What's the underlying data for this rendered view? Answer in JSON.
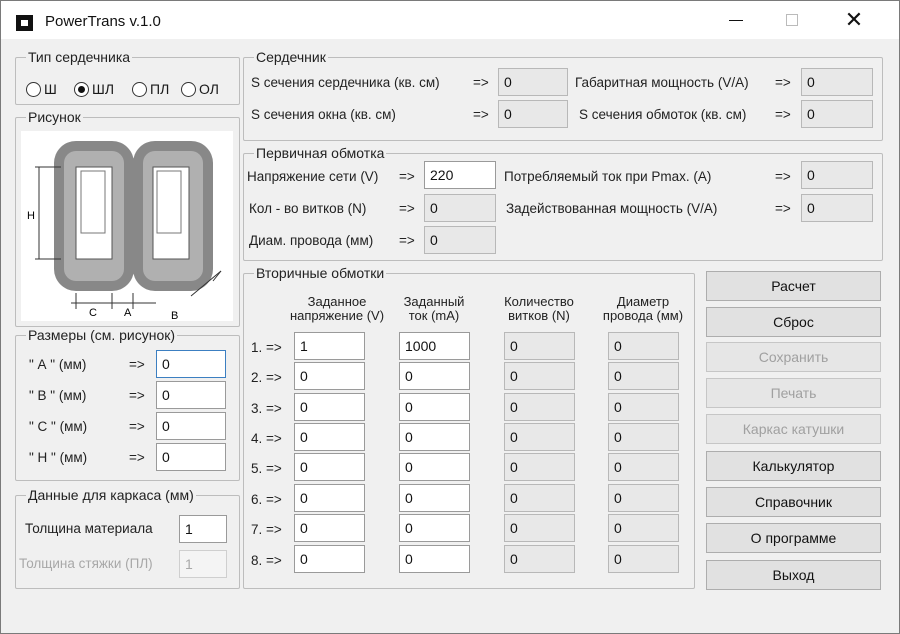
{
  "window": {
    "title": "PowerTrans v.1.0"
  },
  "core_type": {
    "legend": "Тип сердечника",
    "options": [
      {
        "label": "Ш",
        "selected": false
      },
      {
        "label": "ШЛ",
        "selected": true
      },
      {
        "label": "ПЛ",
        "selected": false
      },
      {
        "label": "ОЛ",
        "selected": false
      }
    ]
  },
  "picture": {
    "legend": "Рисунок",
    "labels": {
      "h": "Н",
      "c": "С",
      "a": "А",
      "b": "В"
    }
  },
  "dimensions": {
    "legend": "Размеры (см. рисунок)",
    "arrow": "=>",
    "rows": [
      {
        "label": "\" А \"  (мм)",
        "value": "0"
      },
      {
        "label": "\" В \"  (мм)",
        "value": "0"
      },
      {
        "label": "\" С \"  (мм)",
        "value": "0"
      },
      {
        "label": "\" Н \"  (мм)",
        "value": "0"
      }
    ]
  },
  "frame": {
    "legend": "Данные для каркаса (мм)",
    "thickness_label": "Толщина материала",
    "thickness_value": "1",
    "cheek_label": "Толщина стяжки (ПЛ)",
    "cheek_value": "1"
  },
  "core": {
    "legend": "Сердечник",
    "arrow": "=>",
    "core_area_label": "S сечения сердечника (кв. см)",
    "core_area_value": "0",
    "window_area_label": "S сечения окна (кв. см)",
    "window_area_value": "0",
    "overall_power_label": "Габаритная мощность (V/A)",
    "overall_power_value": "0",
    "winding_area_label": "S сечения обмоток (кв. см)",
    "winding_area_value": "0"
  },
  "primary": {
    "legend": "Первичная обмотка",
    "arrow": "=>",
    "voltage_label": "Напряжение сети (V)",
    "voltage_value": "220",
    "turns_label": "Кол - во витков (N)",
    "turns_value": "0",
    "diam_label": "Диам. провода (мм)",
    "diam_value": "0",
    "current_label": "Потребляемый ток при Pmax. (A)",
    "current_value": "0",
    "power_label": "Задействованная мощность (V/A)",
    "power_value": "0"
  },
  "secondary": {
    "legend": "Вторичные обмотки",
    "headers": {
      "voltage": [
        "Заданное",
        "напряжение (V)"
      ],
      "current": [
        "Заданный",
        "ток (mA)"
      ],
      "turns": [
        "Количество",
        "витков (N)"
      ],
      "diameter": [
        "Диаметр",
        "провода (мм)"
      ]
    },
    "rows": [
      {
        "label": "1. =>",
        "voltage": "1",
        "current": "1000",
        "turns": "0",
        "diameter": "0"
      },
      {
        "label": "2. =>",
        "voltage": "0",
        "current": "0",
        "turns": "0",
        "diameter": "0"
      },
      {
        "label": "3. =>",
        "voltage": "0",
        "current": "0",
        "turns": "0",
        "diameter": "0"
      },
      {
        "label": "4. =>",
        "voltage": "0",
        "current": "0",
        "turns": "0",
        "diameter": "0"
      },
      {
        "label": "5. =>",
        "voltage": "0",
        "current": "0",
        "turns": "0",
        "diameter": "0"
      },
      {
        "label": "6. =>",
        "voltage": "0",
        "current": "0",
        "turns": "0",
        "diameter": "0"
      },
      {
        "label": "7. =>",
        "voltage": "0",
        "current": "0",
        "turns": "0",
        "diameter": "0"
      },
      {
        "label": "8. =>",
        "voltage": "0",
        "current": "0",
        "turns": "0",
        "diameter": "0"
      }
    ]
  },
  "buttons": {
    "calculate": "Расчет",
    "reset": "Сброс",
    "save": "Сохранить",
    "print": "Печать",
    "bobbin": "Каркас катушки",
    "calculator": "Калькулятор",
    "reference": "Справочник",
    "about": "О программе",
    "exit": "Выход"
  }
}
